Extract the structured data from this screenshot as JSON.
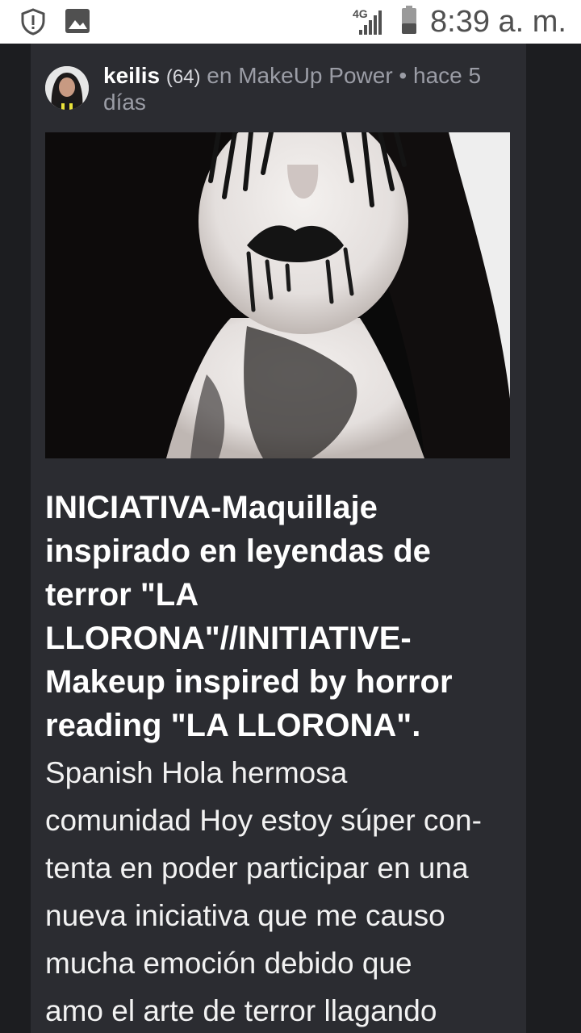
{
  "status_bar": {
    "network": "4G",
    "time": "8:39 a. m.",
    "icons": [
      "alert-shield-icon",
      "image-icon",
      "signal-icon",
      "battery-icon"
    ]
  },
  "post": {
    "author": "keilis",
    "author_level": "(64)",
    "community_text": " en MakeUp Power • hace 5 días",
    "title": "INICIATIVA-Maquillaje inspirado en leyendas de terror \"LA LLORONA\"//INITIATIVE-Makeup inspired by horror reading \"LA LLORONA\".",
    "body_lines": [
      "Spanish Hola hermosa",
      "comunidad Hoy estoy súper con-",
      "tenta en poder participar en una",
      "nueva iniciativa que me causo",
      "mucha emoción debido que",
      "amo el arte de terror llagando"
    ]
  },
  "colors": {
    "background": "#1f2024",
    "card": "#2b2c31",
    "title": "#ffffff",
    "meta": "#9b9da6",
    "status_bar": "#ffffff"
  }
}
